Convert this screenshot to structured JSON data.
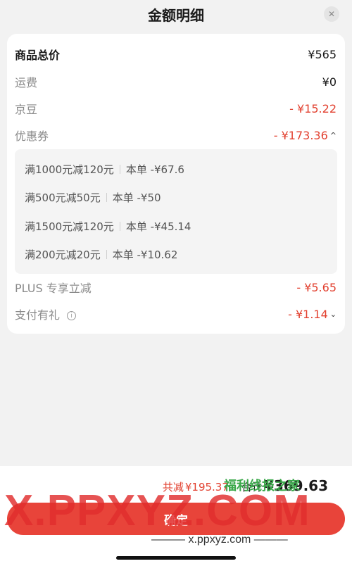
{
  "header": {
    "title": "金额明细",
    "close_symbol": "✕"
  },
  "rows": {
    "subtotal": {
      "label": "商品总价",
      "value": "¥565"
    },
    "shipping": {
      "label": "运费",
      "value": "¥0"
    },
    "jingdou": {
      "label": "京豆",
      "value": "- ¥15.22"
    },
    "coupon": {
      "label": "优惠券",
      "value": "- ¥173.36",
      "chevron": "^"
    },
    "plus": {
      "label": "PLUS 专享立减",
      "value": "- ¥5.65"
    },
    "payment": {
      "label": "支付有礼",
      "info_symbol": "i",
      "value": "- ¥1.14",
      "chevron": "⌄"
    }
  },
  "coupons": [
    {
      "name": "满1000元减120元",
      "detail": "本单 -¥67.6"
    },
    {
      "name": "满500元减50元",
      "detail": "本单 -¥50"
    },
    {
      "name": "满1500元减120元",
      "detail": "本单 -¥45.14"
    },
    {
      "name": "满200元减20元",
      "detail": "本单 -¥10.62"
    }
  ],
  "footer": {
    "discount_label": "共减",
    "discount_value": "¥195.37",
    "total_label": "合计",
    "total_value": "¥369.63",
    "confirm_label": "确定"
  },
  "watermark": {
    "big_text": "X.PPXYZ.COM",
    "logo_text": "福利线报之家",
    "url_text": "——— x.ppxyz.com ———"
  },
  "colors": {
    "accent_red": "#e2402f",
    "button_red": "#e8443a"
  }
}
